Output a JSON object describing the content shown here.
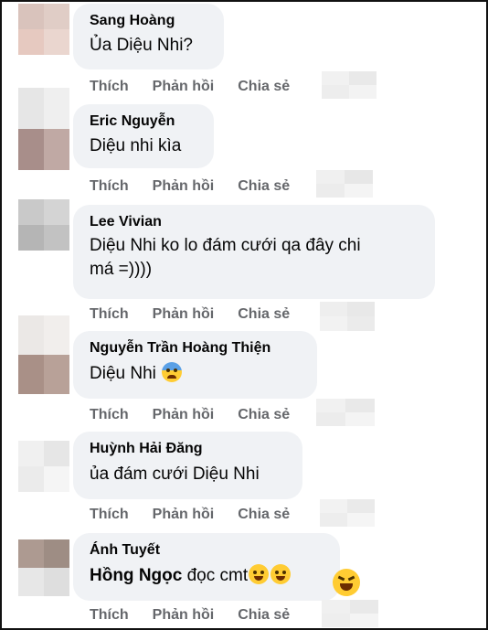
{
  "comments": [
    {
      "name": "Sang Hoàng",
      "text": "Ủa Diệu Nhi?"
    },
    {
      "name": "Eric Nguyễn",
      "text": "Diệu nhi kìa"
    },
    {
      "name": "Lee Vivian",
      "text_line1": "Diệu Nhi ko lo đám cưới qa đây chi",
      "text_line2": "má =))))"
    },
    {
      "name": "Nguyễn Trần Hoàng Thiện",
      "text": "Diệu Nhi"
    },
    {
      "name": "Huỳnh Hải Đăng",
      "text": "ủa đám cưới Diệu Nhi"
    },
    {
      "name": "Ánh Tuyết",
      "tag": "Hồng Ngọc",
      "text": " đọc cmt"
    }
  ],
  "actions": {
    "like": "Thích",
    "reply": "Phản hồi",
    "share": "Chia sẻ"
  },
  "icons": {
    "fear": "fearful-face-emoji",
    "laugh": "tears-of-joy-emoji",
    "grin": "squinting-laugh-emoji"
  },
  "colors": {
    "bubble": "#f0f2f5",
    "action_text": "#65676b",
    "name_text": "#050505"
  }
}
